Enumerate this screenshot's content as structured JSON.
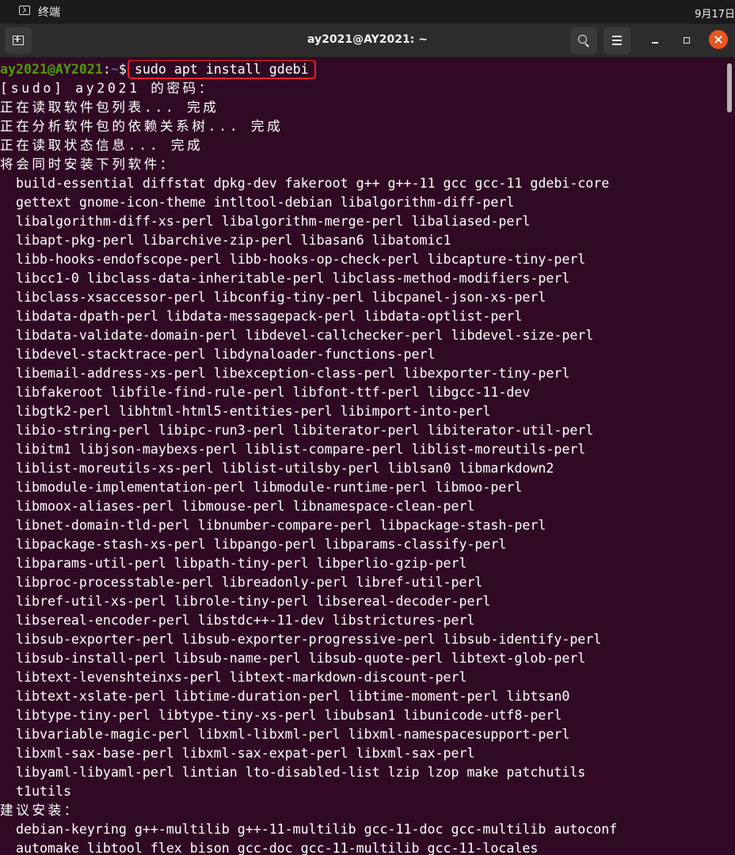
{
  "topbar": {
    "app_name": "终端",
    "clock": "9月17日"
  },
  "window": {
    "title": "ay2021@AY2021: ~"
  },
  "prompt": {
    "user_host": "ay2021@AY2021",
    "sep": ":",
    "path": "~",
    "symbol": "$",
    "command": "sudo apt install gdebi"
  },
  "output_lines": [
    "[sudo] ay2021 的密码：",
    "正在读取软件包列表... 完成",
    "正在分析软件包的依赖关系树... 完成",
    "正在读取状态信息... 完成",
    "将会同时安装下列软件："
  ],
  "install_packages": [
    "build-essential diffstat dpkg-dev fakeroot g++ g++-11 gcc gcc-11 gdebi-core",
    "gettext gnome-icon-theme intltool-debian libalgorithm-diff-perl",
    "libalgorithm-diff-xs-perl libalgorithm-merge-perl libaliased-perl",
    "libapt-pkg-perl libarchive-zip-perl libasan6 libatomic1",
    "libb-hooks-endofscope-perl libb-hooks-op-check-perl libcapture-tiny-perl",
    "libcc1-0 libclass-data-inheritable-perl libclass-method-modifiers-perl",
    "libclass-xsaccessor-perl libconfig-tiny-perl libcpanel-json-xs-perl",
    "libdata-dpath-perl libdata-messagepack-perl libdata-optlist-perl",
    "libdata-validate-domain-perl libdevel-callchecker-perl libdevel-size-perl",
    "libdevel-stacktrace-perl libdynaloader-functions-perl",
    "libemail-address-xs-perl libexception-class-perl libexporter-tiny-perl",
    "libfakeroot libfile-find-rule-perl libfont-ttf-perl libgcc-11-dev",
    "libgtk2-perl libhtml-html5-entities-perl libimport-into-perl",
    "libio-string-perl libipc-run3-perl libiterator-perl libiterator-util-perl",
    "libitm1 libjson-maybexs-perl liblist-compare-perl liblist-moreutils-perl",
    "liblist-moreutils-xs-perl liblist-utilsby-perl liblsan0 libmarkdown2",
    "libmodule-implementation-perl libmodule-runtime-perl libmoo-perl",
    "libmoox-aliases-perl libmouse-perl libnamespace-clean-perl",
    "libnet-domain-tld-perl libnumber-compare-perl libpackage-stash-perl",
    "libpackage-stash-xs-perl libpango-perl libparams-classify-perl",
    "libparams-util-perl libpath-tiny-perl libperlio-gzip-perl",
    "libproc-processtable-perl libreadonly-perl libref-util-perl",
    "libref-util-xs-perl librole-tiny-perl libsereal-decoder-perl",
    "libsereal-encoder-perl libstdc++-11-dev libstrictures-perl",
    "libsub-exporter-perl libsub-exporter-progressive-perl libsub-identify-perl",
    "libsub-install-perl libsub-name-perl libsub-quote-perl libtext-glob-perl",
    "libtext-levenshteinxs-perl libtext-markdown-discount-perl",
    "libtext-xslate-perl libtime-duration-perl libtime-moment-perl libtsan0",
    "libtype-tiny-perl libtype-tiny-xs-perl libubsan1 libunicode-utf8-perl",
    "libvariable-magic-perl libxml-libxml-perl libxml-namespacesupport-perl",
    "libxml-sax-base-perl libxml-sax-expat-perl libxml-sax-perl",
    "libyaml-libyaml-perl lintian lto-disabled-list lzip lzop make patchutils",
    "t1utils"
  ],
  "suggest_header": "建议安装：",
  "suggest_packages": [
    "debian-keyring g++-multilib g++-11-multilib gcc-11-doc gcc-multilib autoconf",
    "automake libtool flex bison gcc-doc gcc-11-multilib gcc-11-locales"
  ],
  "colors": {
    "terminal_bg": "#300a24",
    "prompt_user": "#4e9a06",
    "prompt_path": "#3465a4",
    "highlight_box": "#e8202a",
    "close_button": "#e95420"
  },
  "icons": {
    "app": "terminal-icon",
    "new_tab": "new-tab-icon",
    "search": "search-icon",
    "menu": "hamburger-menu-icon",
    "minimize": "minimize-icon",
    "maximize": "maximize-icon",
    "close": "close-icon"
  }
}
